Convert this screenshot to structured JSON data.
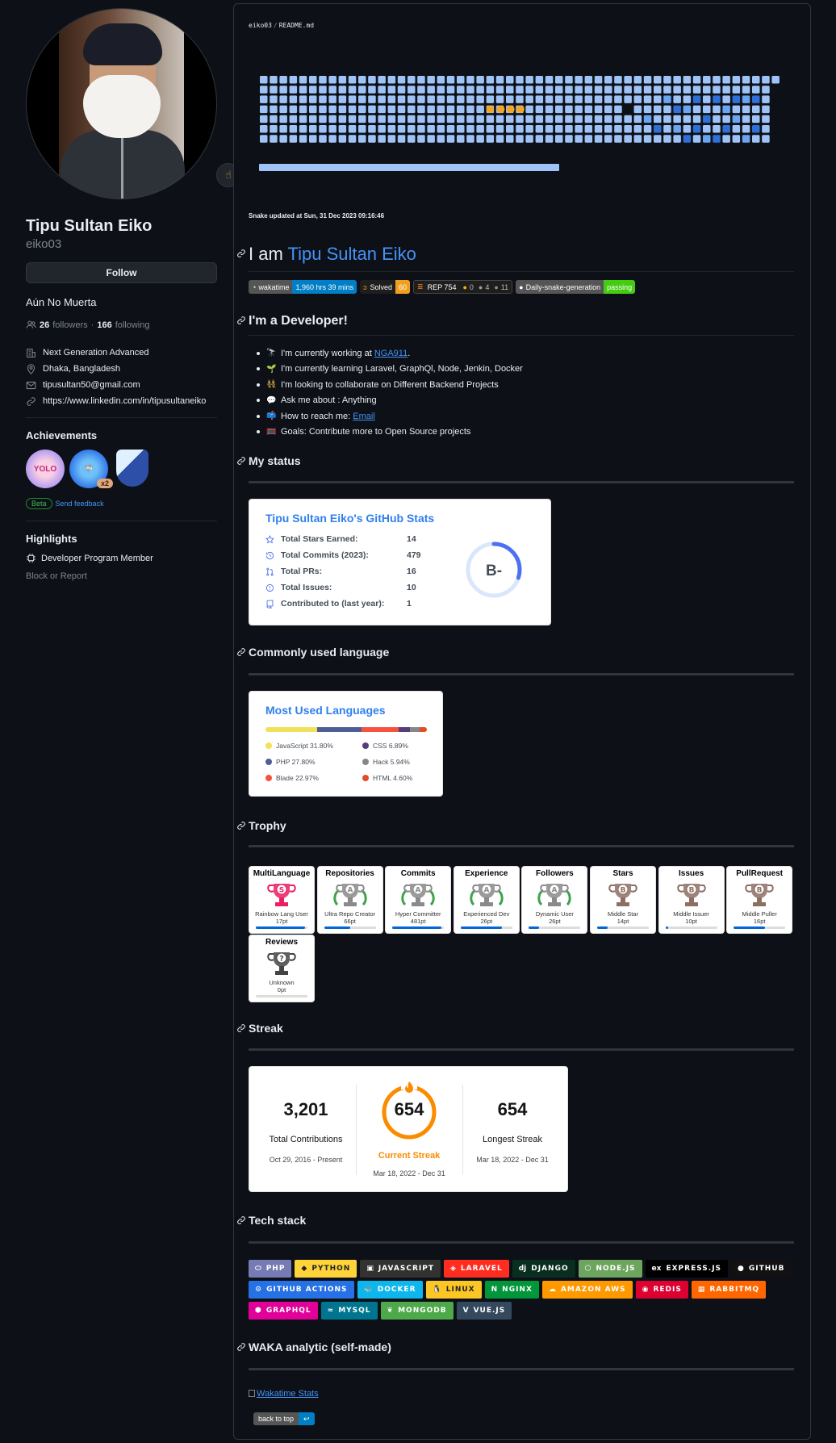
{
  "profile": {
    "name": "Tipu Sultan Eiko",
    "login": "eiko03",
    "follow_label": "Follow",
    "bio": "Aún No Muerta",
    "followers_count": "26",
    "followers_label": "followers",
    "dot": "·",
    "following_count": "166",
    "following_label": "following",
    "status_emoji": "☝",
    "details": {
      "company": "Next Generation Advanced",
      "location": "Dhaka, Bangladesh",
      "email": "tipusultan50@gmail.com",
      "link": "https://www.linkedin.com/in/tipusultaneiko"
    },
    "achievements_title": "Achievements",
    "achievements": [
      {
        "name": "YOLO",
        "badge": ""
      },
      {
        "name": "Pull Shark",
        "badge": "x2"
      },
      {
        "name": "Arctic Code Vault Contributor",
        "badge": ""
      }
    ],
    "beta_label": "Beta",
    "feedback_label": "Send feedback",
    "highlights_title": "Highlights",
    "highlight_item": "Developer Program Member",
    "block_label": "Block or Report"
  },
  "readme": {
    "path_user": "eiko03",
    "path_sep": "/",
    "path_file": "README.md",
    "snake_note": "Snake updated at Sun, 31 Dec 2023 09:16:46",
    "h_intro_prefix": "I am ",
    "h_intro_name": "Tipu Sultan Eiko",
    "badges": {
      "wakatime_label": "wakatime",
      "wakatime_value": "1,960 hrs 39 mins",
      "solved_label": "Solved",
      "solved_value": "60",
      "rep_label": "REP 754",
      "rep_gold": "0",
      "rep_silver": "4",
      "rep_bronze": "11",
      "workflow_label": "Daily-snake-generation",
      "workflow_status": "passing"
    },
    "h_developer": "I'm a Developer!",
    "dev_list": [
      {
        "emoji": "🔭",
        "text": "I'm currently working at ",
        "link": "NGA911",
        "tail": "."
      },
      {
        "emoji": "🌱",
        "text": "I'm currently learning Laravel, GraphQl, Node, Jenkin, Docker",
        "link": "",
        "tail": ""
      },
      {
        "emoji": "👯",
        "text": "I'm looking to collaborate on Different Backend Projects",
        "link": "",
        "tail": ""
      },
      {
        "emoji": "💬",
        "text": "Ask me about : Anything",
        "link": "",
        "tail": ""
      },
      {
        "emoji": "📫",
        "text": "How to reach me: ",
        "link": "Email",
        "tail": ""
      },
      {
        "emoji": "🥅",
        "text": "Goals: Contribute more to Open Source projects",
        "link": "",
        "tail": ""
      }
    ],
    "h_status": "My status",
    "stats_card": {
      "title": "Tipu Sultan Eiko's GitHub Stats",
      "rows": [
        {
          "label": "Total Stars Earned:",
          "value": "14"
        },
        {
          "label": "Total Commits (2023):",
          "value": "479"
        },
        {
          "label": "Total PRs:",
          "value": "16"
        },
        {
          "label": "Total Issues:",
          "value": "10"
        },
        {
          "label": "Contributed to (last year):",
          "value": "1"
        }
      ],
      "rank": "B-",
      "rank_progress": 0.3
    },
    "h_language": "Commonly used language",
    "lang_card": {
      "title": "Most Used Languages",
      "langs": [
        {
          "name": "JavaScript 31.80%",
          "color": "#f1e05a",
          "percent": 31.8
        },
        {
          "name": "PHP 27.80%",
          "color": "#4F5D95",
          "percent": 27.8
        },
        {
          "name": "Blade 22.97%",
          "color": "#f7523f",
          "percent": 22.97
        },
        {
          "name": "CSS 6.89%",
          "color": "#563d7c",
          "percent": 6.89
        },
        {
          "name": "Hack 5.94%",
          "color": "#878787",
          "percent": 5.94
        },
        {
          "name": "HTML 4.60%",
          "color": "#e34c26",
          "percent": 4.6
        }
      ]
    },
    "h_trophy": "Trophy",
    "trophies": [
      {
        "title": "MultiLanguage",
        "rank": "S",
        "subtitle": "Rainbow Lang User",
        "points": "17pt",
        "progress": 0.95
      },
      {
        "title": "Repositories",
        "rank": "A",
        "subtitle": "Ultra Repo Creator",
        "points": "66pt",
        "progress": 0.5
      },
      {
        "title": "Commits",
        "rank": "A",
        "subtitle": "Hyper Committer",
        "points": "481pt",
        "progress": 0.95
      },
      {
        "title": "Experience",
        "rank": "A",
        "subtitle": "Experienced Dev",
        "points": "26pt",
        "progress": 0.8
      },
      {
        "title": "Followers",
        "rank": "A",
        "subtitle": "Dynamic User",
        "points": "26pt",
        "progress": 0.2
      },
      {
        "title": "Stars",
        "rank": "B",
        "subtitle": "Middle Star",
        "points": "14pt",
        "progress": 0.2
      },
      {
        "title": "Issues",
        "rank": "B",
        "subtitle": "Middle Issuer",
        "points": "10pt",
        "progress": 0.05
      },
      {
        "title": "PullRequest",
        "rank": "B",
        "subtitle": "Middle Puller",
        "points": "16pt",
        "progress": 0.6
      },
      {
        "title": "Reviews",
        "rank": "?",
        "subtitle": "Unknown",
        "points": "0pt",
        "progress": 0
      }
    ],
    "h_streak": "Streak",
    "streak": {
      "total": "3,201",
      "total_label": "Total Contributions",
      "total_range": "Oct 29, 2016 - Present",
      "current": "654",
      "current_label": "Current Streak",
      "current_range": "Mar 18, 2022 - Dec 31",
      "longest": "654",
      "longest_label": "Longest Streak",
      "longest_range": "Mar 18, 2022 - Dec 31"
    },
    "h_tech": "Tech stack",
    "tech": [
      {
        "label": "PHP",
        "bg": "#777BB4",
        "icon": "⬭"
      },
      {
        "label": "PYTHON",
        "bg": "#FFD43B",
        "icon": "◆",
        "dark": true
      },
      {
        "label": "JAVASCRIPT",
        "bg": "#323330",
        "icon": "▣"
      },
      {
        "label": "LARAVEL",
        "bg": "#FF2D20",
        "icon": "◈"
      },
      {
        "label": "DJANGO",
        "bg": "#092E20",
        "icon": "dj"
      },
      {
        "label": "NODE.JS",
        "bg": "#6DA55F",
        "icon": "⬡"
      },
      {
        "label": "EXPRESS.JS",
        "bg": "#000000",
        "icon": "ex"
      },
      {
        "label": "GITHUB",
        "bg": "#121011",
        "icon": "●"
      },
      {
        "label": "GITHUB ACTIONS",
        "bg": "#2671E5",
        "icon": "⚙"
      },
      {
        "label": "DOCKER",
        "bg": "#0DB7ED",
        "icon": "🐳"
      },
      {
        "label": "LINUX",
        "bg": "#FCC624",
        "icon": "🐧",
        "dark": true
      },
      {
        "label": "NGINX",
        "bg": "#009639",
        "icon": "N"
      },
      {
        "label": "AMAZON AWS",
        "bg": "#FF9900",
        "icon": "☁"
      },
      {
        "label": "REDIS",
        "bg": "#DD0031",
        "icon": "◉"
      },
      {
        "label": "RABBITMQ",
        "bg": "#FF6600",
        "icon": "▦"
      },
      {
        "label": "GRAPHQL",
        "bg": "#E10098",
        "icon": "⬢"
      },
      {
        "label": "MYSQL",
        "bg": "#00758F",
        "icon": "≈"
      },
      {
        "label": "MONGODB",
        "bg": "#4EA94B",
        "icon": "❦"
      },
      {
        "label": "VUE.JS",
        "bg": "#35495E",
        "icon": "V"
      }
    ],
    "h_waka": "WAKA analytic (self-made)",
    "waka_alt": "Wakatime Stats",
    "back_to_top": "back to top",
    "back_icon": "↩"
  },
  "colors": {
    "accent": "#4493f8",
    "snake_light": "#9fc3f7",
    "snake_mid": "#6ba4f0",
    "snake_dark": "#2f6fd6",
    "snake_head": "#f5a623"
  }
}
